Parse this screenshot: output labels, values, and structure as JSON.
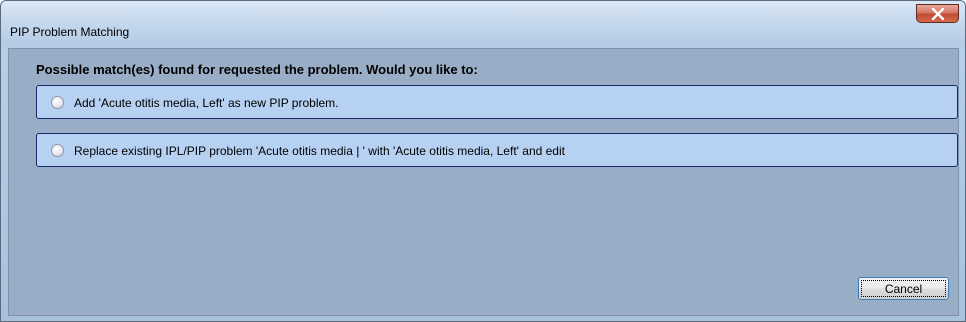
{
  "window": {
    "title": "PIP Problem Matching"
  },
  "prompt": "Possible match(es) found for requested the problem.   Would you like to:",
  "options": [
    {
      "label": "Add 'Acute otitis media, Left' as new PIP problem.",
      "selected": false
    },
    {
      "label": "Replace existing IPL/PIP problem 'Acute otitis media | ' with 'Acute otitis media, Left' and edit",
      "selected": false
    }
  ],
  "buttons": {
    "cancel_label": "Cancel"
  },
  "colors": {
    "option_fill": "#b6d1f2",
    "option_border": "#1a2a6c",
    "client_background": "#99aec6",
    "close_button": "#c04b32"
  },
  "icons": {
    "close": "close-x-icon"
  }
}
